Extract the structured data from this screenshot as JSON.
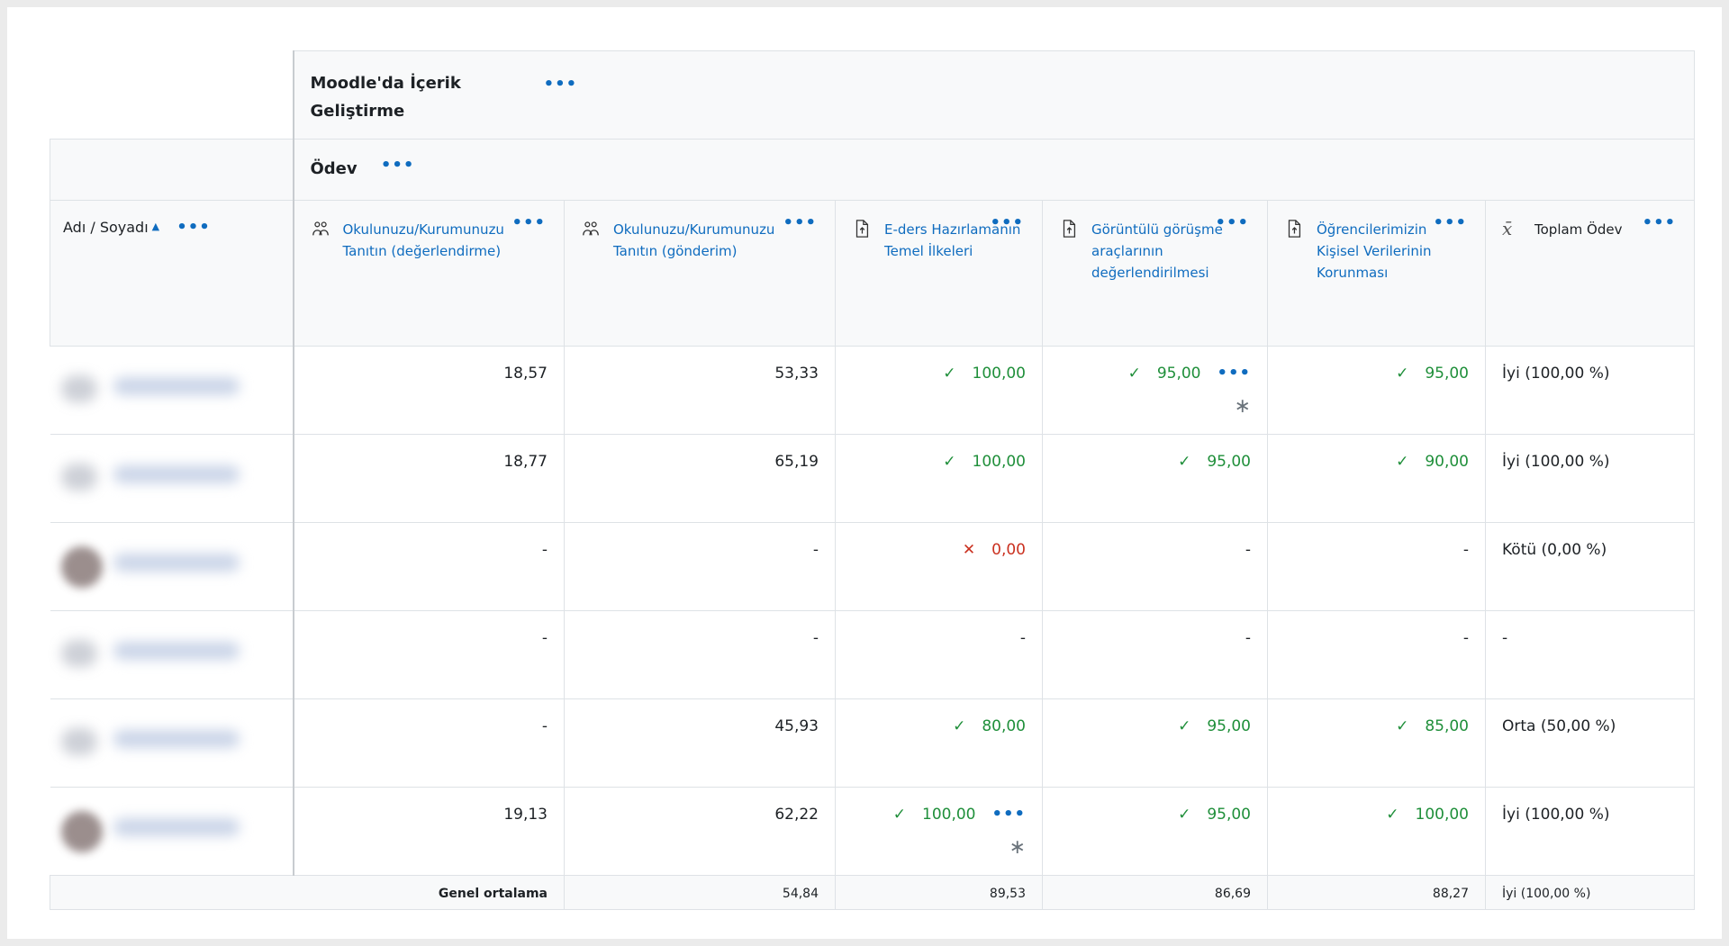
{
  "category": {
    "title": "Moodle'da İçerik Geliştirme",
    "subcategory": "Ödev"
  },
  "columns": {
    "name_header": "Adı / Soyadı",
    "items": [
      {
        "label": "Okulunuzu/Kurumunuzu Tanıtın (değerlendirme)",
        "icon": "workshop-icon"
      },
      {
        "label": "Okulunuzu/Kurumunuzu Tanıtın (gönderim)",
        "icon": "workshop-icon"
      },
      {
        "label": "E-ders Hazırlamanın Temel İlkeleri",
        "icon": "assignment-icon"
      },
      {
        "label": "Görüntülü görüşme araçlarının değerlendirilmesi",
        "icon": "assignment-icon"
      },
      {
        "label": "Öğrencilerimizin Kişisel Verilerinin Korunması",
        "icon": "assignment-icon"
      },
      {
        "label": "Toplam Ödev",
        "icon": "mean-icon"
      }
    ]
  },
  "rows": [
    {
      "cells": [
        "18,57",
        "53,33",
        "100,00",
        "95,00",
        "95,00",
        "İyi (100,00 %)"
      ]
    },
    {
      "cells": [
        "18,77",
        "65,19",
        "100,00",
        "95,00",
        "90,00",
        "İyi (100,00 %)"
      ]
    },
    {
      "cells": [
        "-",
        "-",
        "0,00",
        "-",
        "-",
        "Kötü (0,00 %)"
      ]
    },
    {
      "cells": [
        "-",
        "-",
        "-",
        "-",
        "-",
        "-"
      ]
    },
    {
      "cells": [
        "-",
        "45,93",
        "80,00",
        "95,00",
        "85,00",
        "Orta (50,00 %)"
      ]
    },
    {
      "cells": [
        "19,13",
        "62,22",
        "100,00",
        "95,00",
        "100,00",
        "İyi (100,00 %)"
      ]
    }
  ],
  "average": {
    "label": "Genel ortalama",
    "values": [
      "54,84",
      "89,53",
      "86,69",
      "88,27",
      "İyi (100,00 %)"
    ]
  },
  "menu_dots": "•••",
  "status_colors": {
    "pass": "#1f8f3a",
    "fail": "#ca3120",
    "link": "#0f6cbf"
  }
}
